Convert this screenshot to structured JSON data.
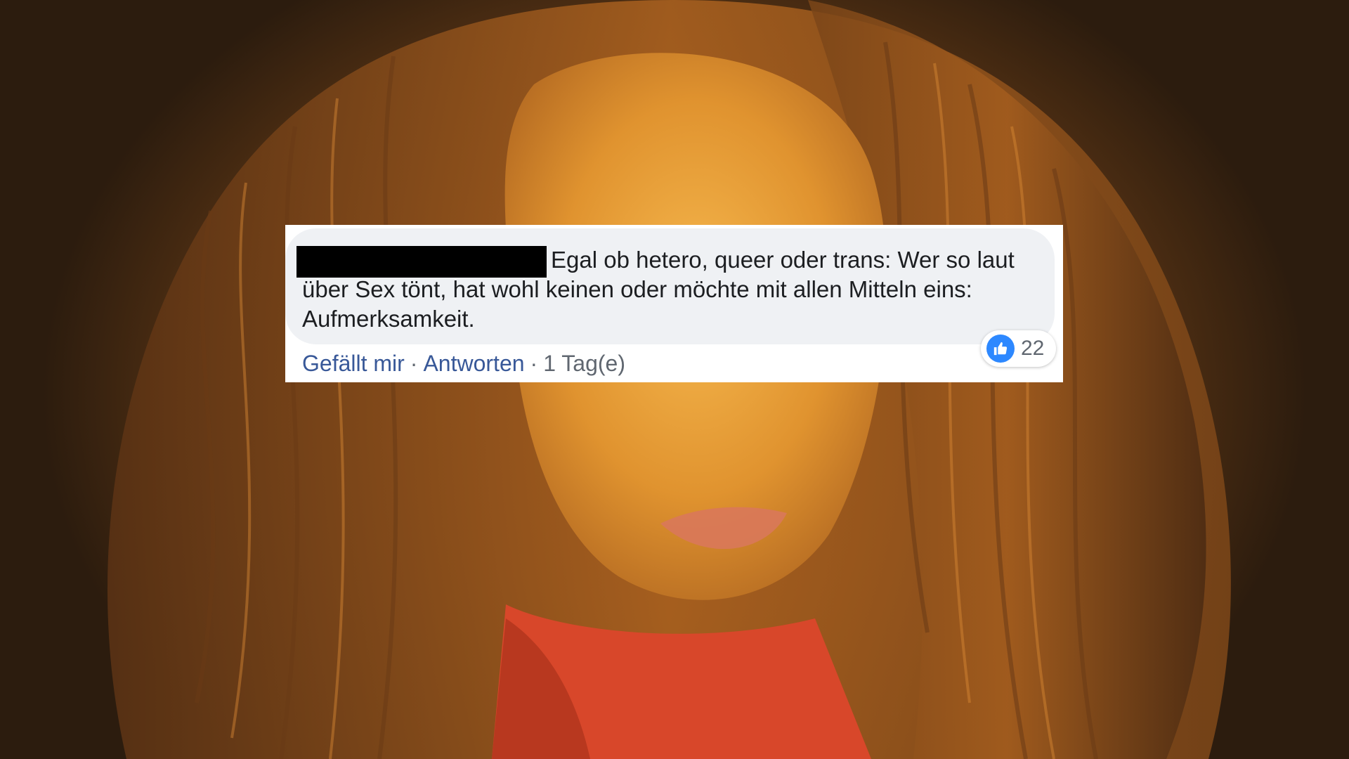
{
  "comment": {
    "text": "Egal ob hetero, queer oder trans: Wer so laut über Sex tönt, hat wohl keinen oder möchte mit allen Mitteln eins: Aufmerksamkeit.",
    "actions": {
      "like_label": "Gefällt mir",
      "separator": "·",
      "reply_label": "Antworten",
      "timestamp": "1 Tag(e)"
    },
    "reactions": {
      "icon": "thumbs-up-icon",
      "count": "22",
      "color": "#2d88ff"
    }
  },
  "colors": {
    "link": "#385898",
    "bubble": "#eff1f4",
    "text": "#1c1e21",
    "meta": "#606770"
  }
}
